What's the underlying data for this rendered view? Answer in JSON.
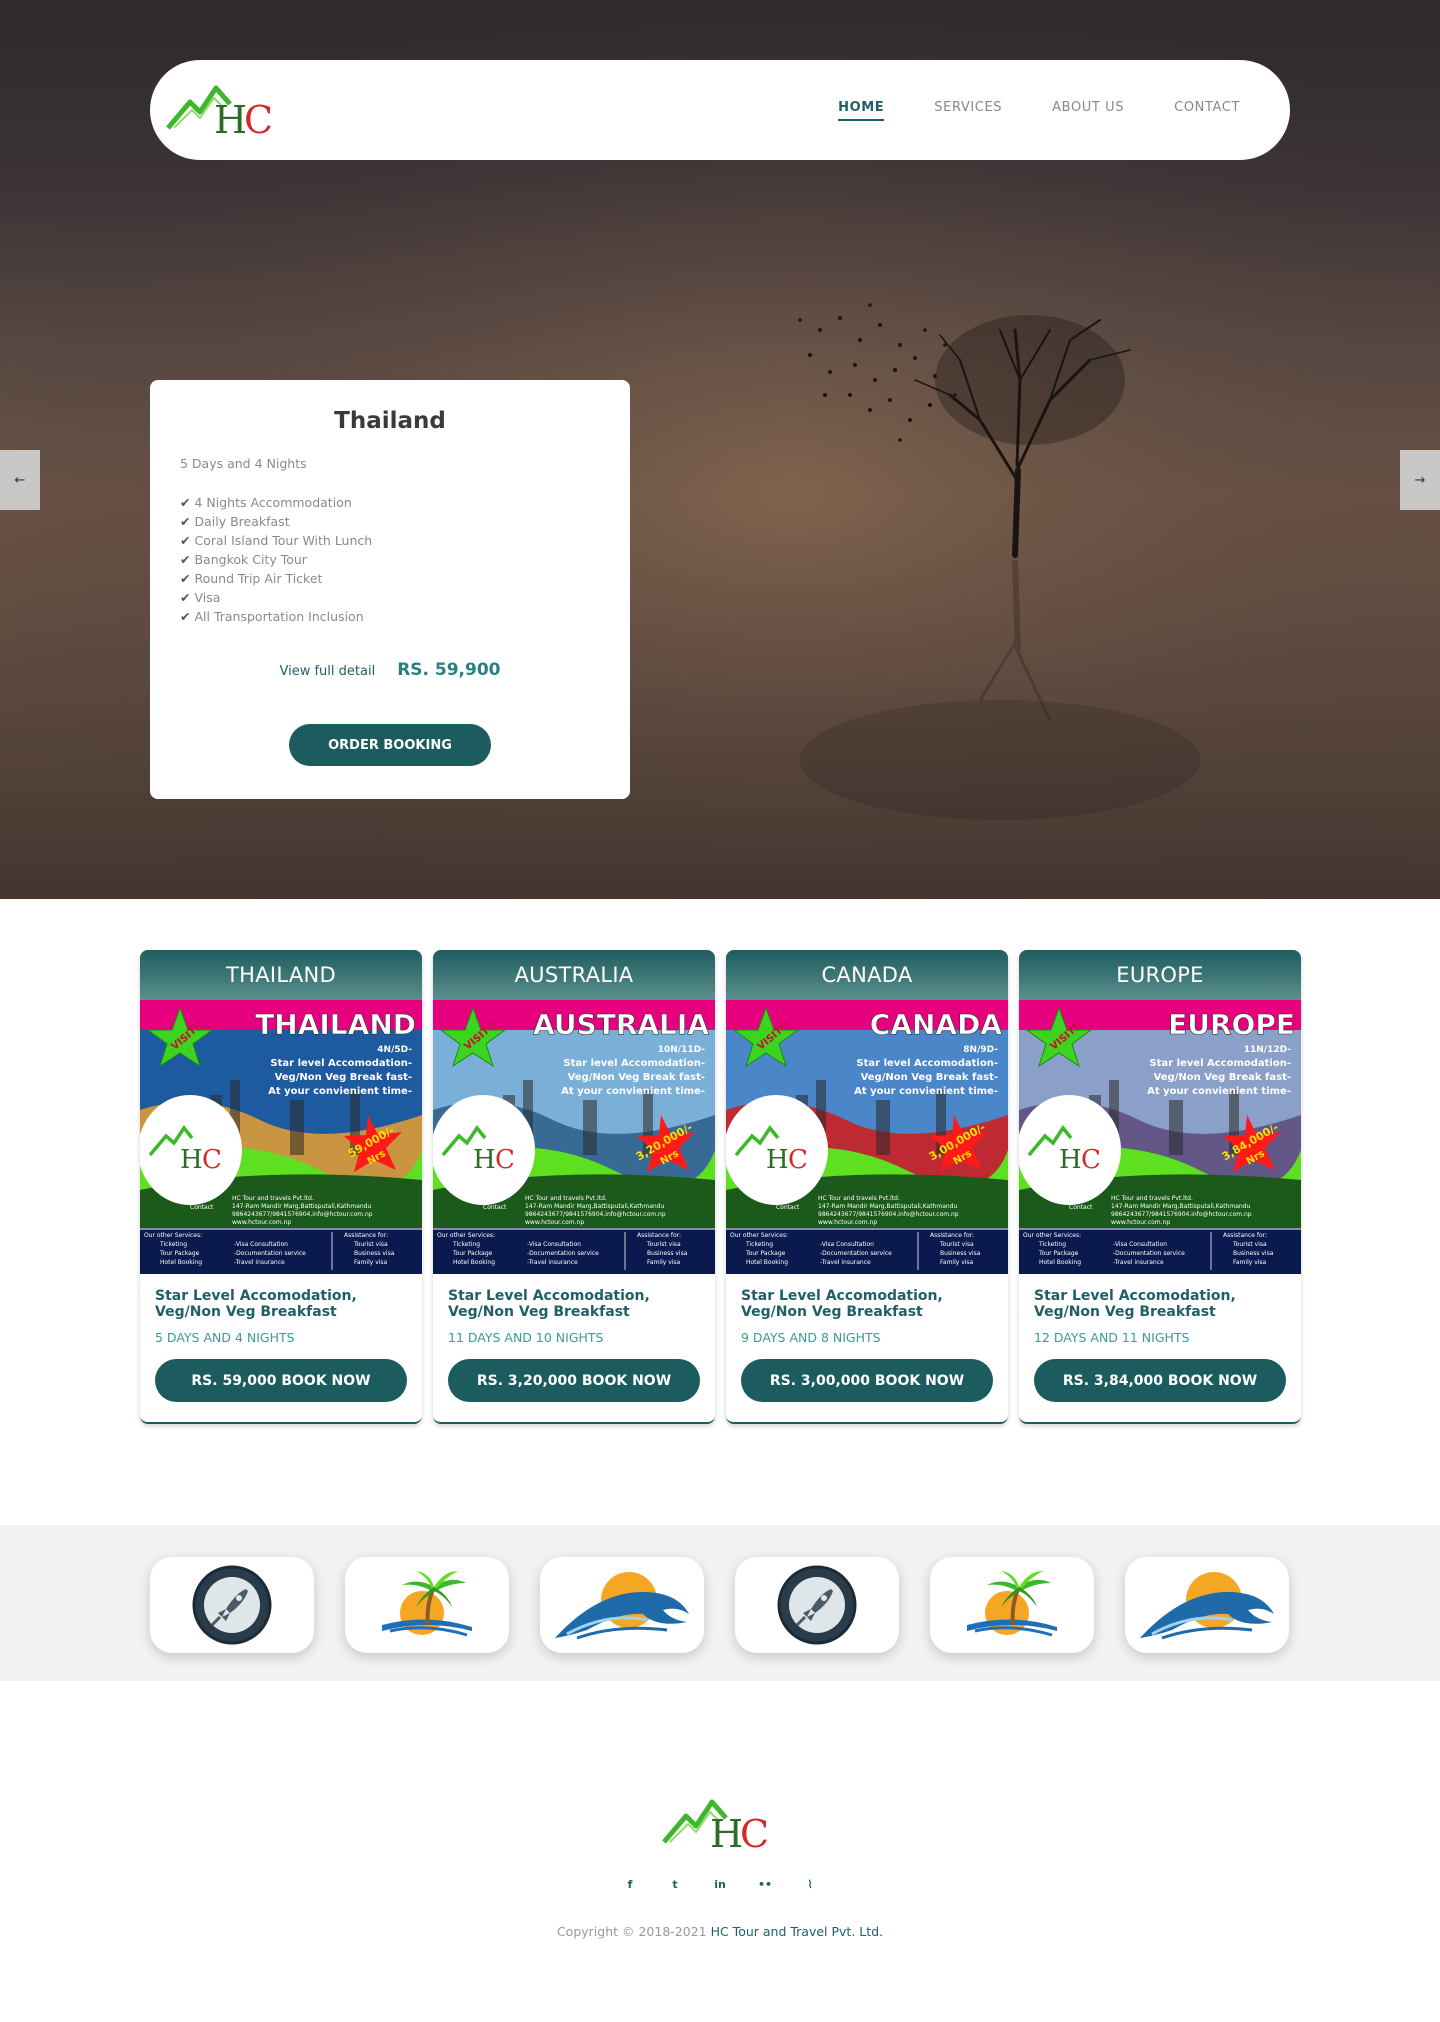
{
  "brand": {
    "logo_text": "HC",
    "colors": {
      "primary": "#1c5b5e",
      "accent_teal": "#2a8080",
      "logo_green": "#3cb82a",
      "logo_red": "#d42a2a",
      "poster_pink": "#e6007e"
    }
  },
  "nav": {
    "items": [
      {
        "label": "HOME",
        "active": true
      },
      {
        "label": "SERVICES",
        "active": false
      },
      {
        "label": "ABOUT US",
        "active": false
      },
      {
        "label": "CONTACT",
        "active": false
      }
    ]
  },
  "slider": {
    "prev_label": "←",
    "next_label": "→",
    "card": {
      "title": "Thailand",
      "duration": "5 Days and 4 Nights",
      "features": [
        "4 Nights Accommodation",
        "Daily Breakfast",
        "Coral Island Tour With Lunch",
        "Bangkok City Tour",
        "Round Trip Air Ticket",
        "Visa",
        "All Transportation Inclusion"
      ],
      "check_glyph": "✔",
      "detail_link": "View full detail",
      "price": "RS. 59,900",
      "order_button": "ORDER BOOKING"
    }
  },
  "packages": [
    {
      "name": "THAILAND",
      "poster": {
        "title": "THAILAND",
        "nights": "4N/5D-",
        "price": "59,000/-",
        "scene_color": "#e8a030",
        "sky_color": "#1e5aa0"
      },
      "desc": "Star Level Accomodation, Veg/Non Veg Breakfast",
      "days": "5 DAYS AND 4 NIGHTS",
      "button": "RS. 59,000 BOOK NOW"
    },
    {
      "name": "AUSTRALIA",
      "poster": {
        "title": "AUSTRALIA",
        "nights": "10N/11D-",
        "price": "3,20,000/-",
        "scene_color": "#2c5f8a",
        "sky_color": "#7ab0d8"
      },
      "desc": "Star Level Accomodation, Veg/Non Veg Breakfast",
      "days": "11 DAYS AND 10 NIGHTS",
      "button": "RS. 3,20,000 BOOK NOW"
    },
    {
      "name": "CANADA",
      "poster": {
        "title": "CANADA",
        "nights": "8N/9D-",
        "price": "3,00,000/-",
        "scene_color": "#d11a1a",
        "sky_color": "#4a86c8"
      },
      "desc": "Star Level Accomodation, Veg/Non Veg Breakfast",
      "days": "9 DAYS AND 8 NIGHTS",
      "button": "RS. 3,00,000 BOOK NOW"
    },
    {
      "name": "EUROPE",
      "poster": {
        "title": "EUROPE",
        "nights": "11N/12D-",
        "price": "3,84,000/-",
        "scene_color": "#5a4a7a",
        "sky_color": "#8aa0c8"
      },
      "desc": "Star Level Accomodation, Veg/Non Veg Breakfast",
      "days": "12 DAYS AND 11 NIGHTS",
      "button": "RS. 3,84,000 BOOK NOW"
    }
  ],
  "poster_common": {
    "visit": "VISIT!!",
    "lines": [
      "Star level Accomodation-",
      "Veg/Non Veg Break fast-",
      "At your convienient time-"
    ],
    "currency": "Nrs",
    "contact_label": "Contact",
    "company": "HC Tour and travels Pvt.ltd.",
    "address": "147-Ram Mandir Marg,Battisputali,Kathmandu",
    "phones": "9864243677/9841576904,info@hctour.com.np",
    "web": "www.hctour.com.np",
    "services_head": "Our other Services:",
    "services": [
      "Ticketing",
      "Tour Package",
      "Hotel Booking"
    ],
    "services2": [
      "-Visa Consultation",
      "-Documentation service",
      "-Travel insurance"
    ],
    "assist_head": "Assistance for:",
    "assist": [
      "Tourist visa",
      "Business visa",
      "Family visa"
    ]
  },
  "partners": [
    {
      "icon": "rocket-logo-icon"
    },
    {
      "icon": "palm-island-logo-icon"
    },
    {
      "icon": "wave-logo-icon"
    },
    {
      "icon": "rocket-logo-icon"
    },
    {
      "icon": "palm-island-logo-icon"
    },
    {
      "icon": "wave-logo-icon"
    }
  ],
  "footer": {
    "social": [
      {
        "icon": "facebook-icon",
        "glyph": "f"
      },
      {
        "icon": "twitter-icon",
        "glyph": "t"
      },
      {
        "icon": "linkedin-icon",
        "glyph": "in"
      },
      {
        "icon": "flickr-icon",
        "glyph": "••"
      },
      {
        "icon": "rss-icon",
        "glyph": "⌇"
      }
    ],
    "copyright_prefix": "Copyright © 2018-2021 ",
    "company": "HC Tour and Travel Pvt. Ltd."
  }
}
